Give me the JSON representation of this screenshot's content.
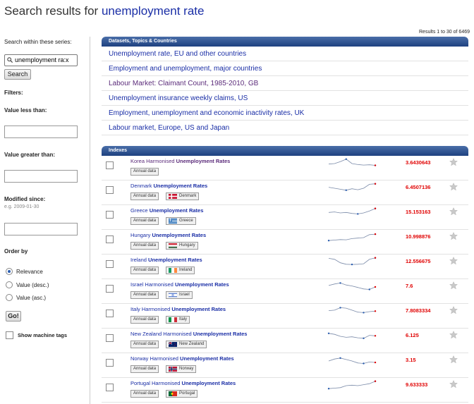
{
  "title": {
    "prefix": "Search results for ",
    "query": "unemployment rate"
  },
  "sidebar": {
    "search_within_label": "Search within these series:",
    "search_value": "unemployment ra:x",
    "search_button": "Search",
    "filters_label": "Filters:",
    "value_less_label": "Value less than:",
    "value_greater_label": "Value greater than:",
    "modified_label": "Modified since:",
    "modified_hint": "e.g. 2009-01-30",
    "order_label": "Order by",
    "order_options": [
      {
        "label": "Relevance",
        "selected": true
      },
      {
        "label": "Value (desc.)",
        "selected": false
      },
      {
        "label": "Value (asc.)",
        "selected": false
      }
    ],
    "go_button": "Go!",
    "machine_tags_label": "Show machine tags"
  },
  "results_count": "Results 1 to 30 of 6469",
  "topics_header": "Datasets, Topics & Countries",
  "topics": [
    "Unemployment rate, EU and other countries",
    "Employment and unemployment, major countries",
    "Labour Market: Claimant Count, 1985-2010, GB",
    "Unemployment insurance weekly claims, US",
    "Employment, unemployment and economic inactivity rates, UK",
    "Labour market, Europe, US and Japan"
  ],
  "indexes_header": "Indexes",
  "annual_tag": "Annual data",
  "indexes": [
    {
      "pre": "Korea Harmonised ",
      "bold": "Unemployment Rates",
      "post": "",
      "country": "",
      "value": "3.6430643",
      "visited": true,
      "flag": "none",
      "spark": [
        0.55,
        0.5,
        0.3,
        0.05,
        0.5,
        0.6,
        0.65,
        0.62,
        0.68
      ]
    },
    {
      "pre": "Denmark ",
      "bold": "Unemployment Rates",
      "post": "",
      "country": "Denmark",
      "value": "6.4507136",
      "visited": false,
      "flag": "denmark",
      "spark": [
        0.4,
        0.5,
        0.6,
        0.7,
        0.55,
        0.65,
        0.5,
        0.1,
        0.05
      ]
    },
    {
      "pre": "Greece ",
      "bold": "Unemployment Rates",
      "post": "",
      "country": "Greece",
      "value": "15.153163",
      "visited": false,
      "flag": "greece",
      "spark": [
        0.45,
        0.4,
        0.5,
        0.45,
        0.55,
        0.6,
        0.5,
        0.3,
        0.05
      ]
    },
    {
      "pre": "Hungary ",
      "bold": "Unemployment Rates",
      "post": "",
      "country": "Hungary",
      "value": "10.998876",
      "visited": false,
      "flag": "hungary",
      "spark": [
        0.8,
        0.75,
        0.7,
        0.72,
        0.6,
        0.55,
        0.5,
        0.2,
        0.15
      ]
    },
    {
      "pre": "Ireland ",
      "bold": "Unemployment Rates",
      "post": "",
      "country": "Ireland",
      "value": "12.556675",
      "visited": false,
      "flag": "ireland",
      "spark": [
        0.1,
        0.2,
        0.55,
        0.7,
        0.72,
        0.7,
        0.65,
        0.2,
        0.05
      ]
    },
    {
      "pre": "Israel Harmonised ",
      "bold": "Unemployment Rates",
      "post": "",
      "country": "Israel",
      "value": "7.6",
      "visited": false,
      "flag": "israel",
      "spark": [
        0.35,
        0.2,
        0.1,
        0.3,
        0.4,
        0.55,
        0.7,
        0.75,
        0.5
      ]
    },
    {
      "pre": "Italy Harmonised ",
      "bold": "Unemployment Rates",
      "post": "",
      "country": "Italy",
      "value": "7.8083334",
      "visited": false,
      "flag": "italy",
      "spark": [
        0.4,
        0.35,
        0.1,
        0.15,
        0.35,
        0.55,
        0.6,
        0.5,
        0.45
      ]
    },
    {
      "pre": "New Zealand Harmonised ",
      "bold": "Unemployment Rates",
      "post": "",
      "country": "New Zealand",
      "value": "6.125",
      "visited": false,
      "flag": "nz",
      "spark": [
        0.2,
        0.3,
        0.5,
        0.6,
        0.55,
        0.65,
        0.7,
        0.4,
        0.45
      ]
    },
    {
      "pre": "Norway Harmonised ",
      "bold": "Unemployment Rates",
      "post": "",
      "country": "Norway",
      "value": "3.15",
      "visited": false,
      "flag": "norway",
      "spark": [
        0.5,
        0.3,
        0.2,
        0.35,
        0.5,
        0.7,
        0.75,
        0.6,
        0.65
      ]
    },
    {
      "pre": "Portugal Harmonised ",
      "bold": "Unemployment Rates",
      "post": "",
      "country": "Portugal",
      "value": "9.633333",
      "visited": false,
      "flag": "portugal",
      "spark": [
        0.8,
        0.75,
        0.7,
        0.5,
        0.45,
        0.5,
        0.4,
        0.3,
        0.05
      ]
    }
  ],
  "colors": {
    "link": "#1a2ea6",
    "visited": "#5b2b7a",
    "value": "#e00000",
    "header": "#1e4180"
  }
}
